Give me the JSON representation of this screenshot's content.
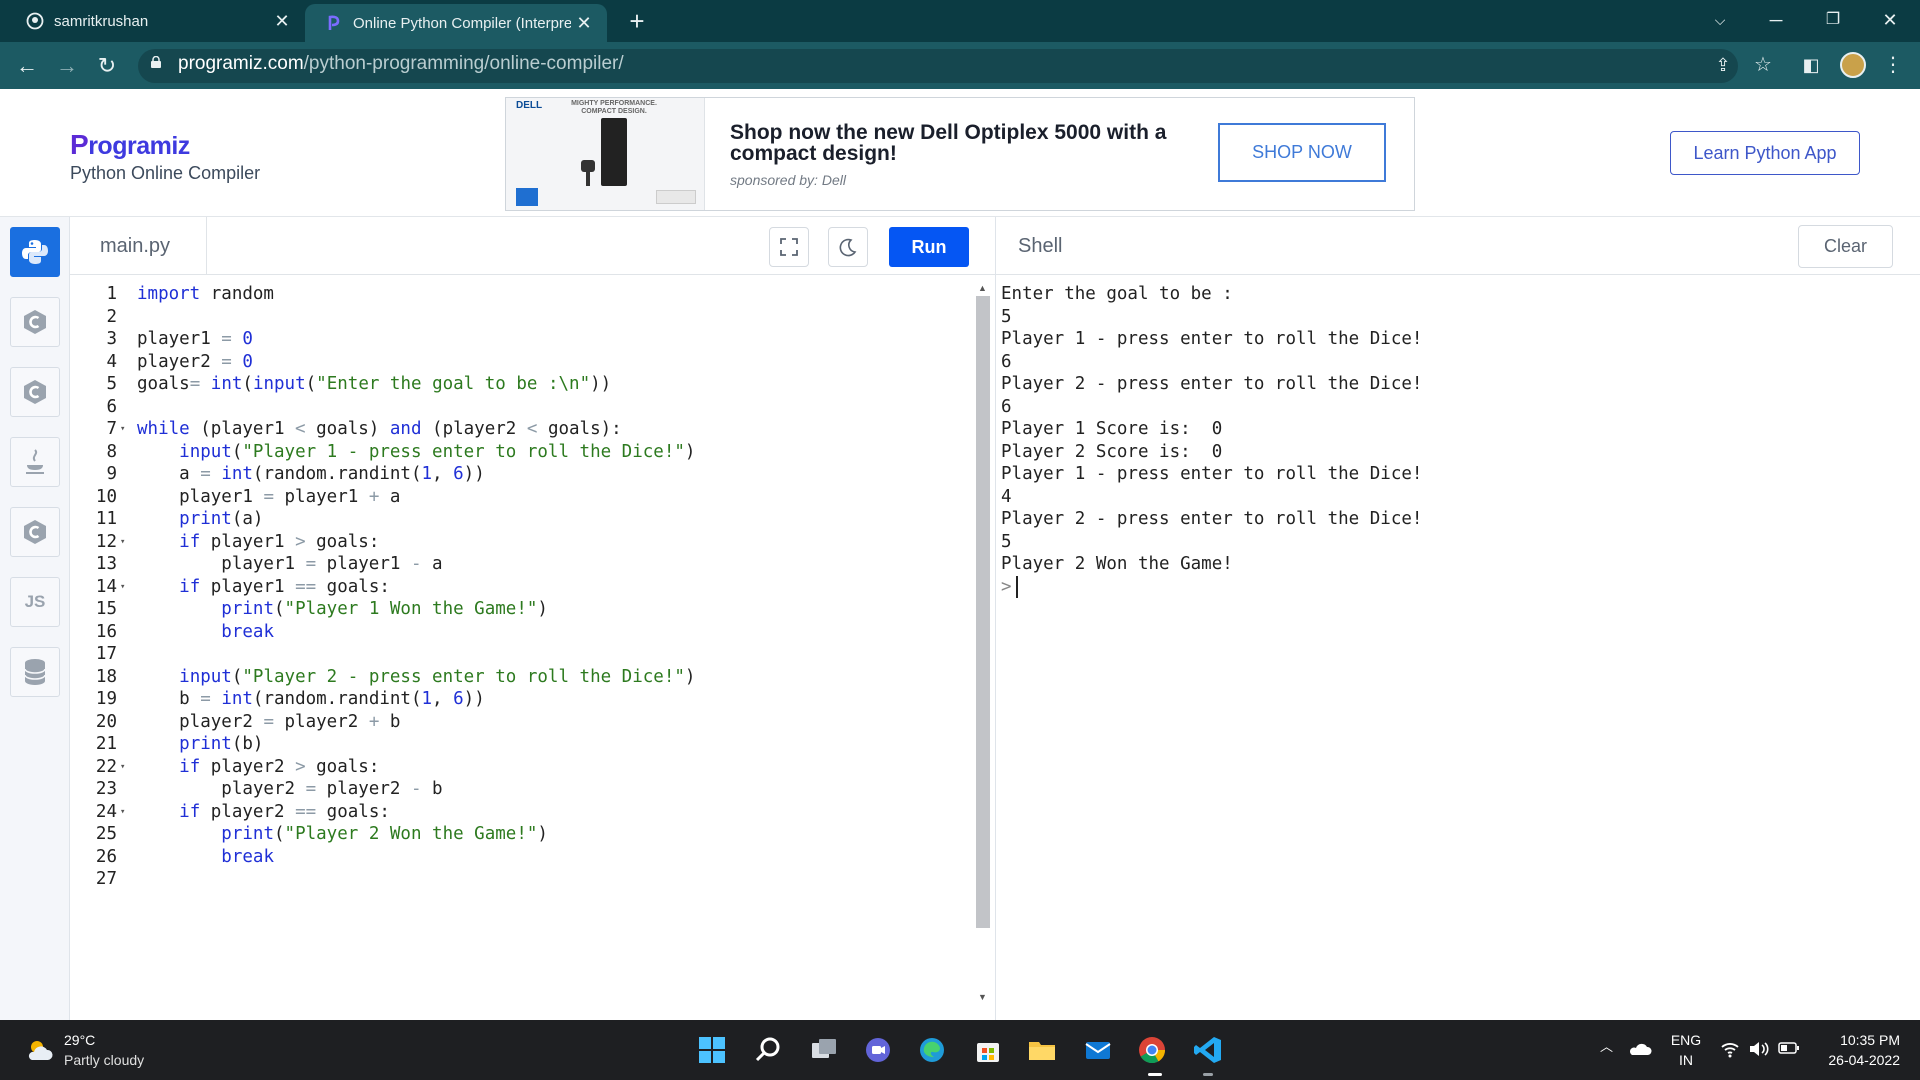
{
  "browser": {
    "tabs": [
      {
        "title": "samritkrushan",
        "icon": "github-icon"
      },
      {
        "title": "Online Python Compiler (Interpre",
        "icon": "programiz-icon"
      }
    ],
    "url_host": "programiz.com",
    "url_path": "/python-programming/online-compiler/"
  },
  "header": {
    "logo_text": "rogramiz",
    "logo_initial": "P",
    "subtitle": "Python Online Compiler",
    "learn_button": "Learn Python App"
  },
  "ad": {
    "brand": "DELL",
    "tagline": "MIGHTY PERFORMANCE. COMPACT DESIGN.",
    "headline": "Shop now the new Dell Optiplex 5000 with a compact design!",
    "sponsor": "sponsored by: Dell",
    "cta": "SHOP NOW"
  },
  "sidebar": {
    "items": [
      {
        "name": "python",
        "icon": "python-icon"
      },
      {
        "name": "r",
        "icon": "c-icon"
      },
      {
        "name": "c",
        "icon": "c-icon"
      },
      {
        "name": "java",
        "icon": "java-icon"
      },
      {
        "name": "cpp",
        "icon": "c-icon"
      },
      {
        "name": "js",
        "label": "JS"
      },
      {
        "name": "sql",
        "icon": "database-icon"
      }
    ]
  },
  "editor": {
    "filename": "main.py",
    "run_label": "Run",
    "lines": [
      {
        "n": "1",
        "fold": false,
        "html": "<span class='k'>import</span> random"
      },
      {
        "n": "2",
        "fold": false,
        "html": ""
      },
      {
        "n": "3",
        "fold": false,
        "html": "player1 <span class='o'>=</span> <span class='n'>0</span>"
      },
      {
        "n": "4",
        "fold": false,
        "html": "player2 <span class='o'>=</span> <span class='n'>0</span>"
      },
      {
        "n": "5",
        "fold": false,
        "html": "goals<span class='o'>=</span> <span class='f'>int</span>(<span class='f'>input</span>(<span class='s'>\"Enter the goal to be :\\n\"</span>))"
      },
      {
        "n": "6",
        "fold": false,
        "html": ""
      },
      {
        "n": "7",
        "fold": true,
        "html": "<span class='k'>while</span> (player1 <span class='o'>&lt;</span> goals) <span class='k'>and</span> (player2 <span class='o'>&lt;</span> goals):"
      },
      {
        "n": "8",
        "fold": false,
        "html": "    <span class='f'>input</span>(<span class='s'>\"Player 1 - press enter to roll the Dice!\"</span>)"
      },
      {
        "n": "9",
        "fold": false,
        "html": "    a <span class='o'>=</span> <span class='f'>int</span>(random.randint(<span class='n'>1</span>, <span class='n'>6</span>))"
      },
      {
        "n": "10",
        "fold": false,
        "html": "    player1 <span class='o'>=</span> player1 <span class='o'>+</span> a"
      },
      {
        "n": "11",
        "fold": false,
        "html": "    <span class='f'>print</span>(a)"
      },
      {
        "n": "12",
        "fold": true,
        "html": "    <span class='k'>if</span> player1 <span class='o'>&gt;</span> goals:"
      },
      {
        "n": "13",
        "fold": false,
        "html": "        player1 <span class='o'>=</span> player1 <span class='o'>-</span> a"
      },
      {
        "n": "14",
        "fold": true,
        "html": "    <span class='k'>if</span> player1 <span class='o'>==</span> goals:"
      },
      {
        "n": "15",
        "fold": false,
        "html": "        <span class='f'>print</span>(<span class='s'>\"Player 1 Won the Game!\"</span>)"
      },
      {
        "n": "16",
        "fold": false,
        "html": "        <span class='k'>break</span>"
      },
      {
        "n": "17",
        "fold": false,
        "html": ""
      },
      {
        "n": "18",
        "fold": false,
        "html": "    <span class='f'>input</span>(<span class='s'>\"Player 2 - press enter to roll the Dice!\"</span>)"
      },
      {
        "n": "19",
        "fold": false,
        "html": "    b <span class='o'>=</span> <span class='f'>int</span>(random.randint(<span class='n'>1</span>, <span class='n'>6</span>))"
      },
      {
        "n": "20",
        "fold": false,
        "html": "    player2 <span class='o'>=</span> player2 <span class='o'>+</span> b"
      },
      {
        "n": "21",
        "fold": false,
        "html": "    <span class='f'>print</span>(b)"
      },
      {
        "n": "22",
        "fold": true,
        "html": "    <span class='k'>if</span> player2 <span class='o'>&gt;</span> goals:"
      },
      {
        "n": "23",
        "fold": false,
        "html": "        player2 <span class='o'>=</span> player2 <span class='o'>-</span> b"
      },
      {
        "n": "24",
        "fold": true,
        "html": "    <span class='k'>if</span> player2 <span class='o'>==</span> goals:"
      },
      {
        "n": "25",
        "fold": false,
        "html": "        <span class='f'>print</span>(<span class='s'>\"Player 2 Won the Game!\"</span>)"
      },
      {
        "n": "26",
        "fold": false,
        "html": "        <span class='k'>break</span>"
      },
      {
        "n": "27",
        "fold": false,
        "html": ""
      }
    ]
  },
  "shell": {
    "title": "Shell",
    "clear_label": "Clear",
    "output": [
      "Enter the goal to be :",
      "5",
      "Player 1 - press enter to roll the Dice!",
      "6",
      "Player 2 - press enter to roll the Dice!",
      "6",
      "Player 1 Score is:  0",
      "Player 2 Score is:  0",
      "Player 1 - press enter to roll the Dice!",
      "4",
      "Player 2 - press enter to roll the Dice!",
      "5",
      "Player 2 Won the Game!"
    ],
    "prompt": ">"
  },
  "taskbar": {
    "temperature": "29°C",
    "condition": "Partly cloudy",
    "lang_top": "ENG",
    "lang_bottom": "IN",
    "time": "10:35 PM",
    "date": "26-04-2022"
  },
  "colors": {
    "run": "#0556f3",
    "chrome": "#1c5a63",
    "keyword": "#1f2fd6",
    "string": "#2d7a1f"
  }
}
